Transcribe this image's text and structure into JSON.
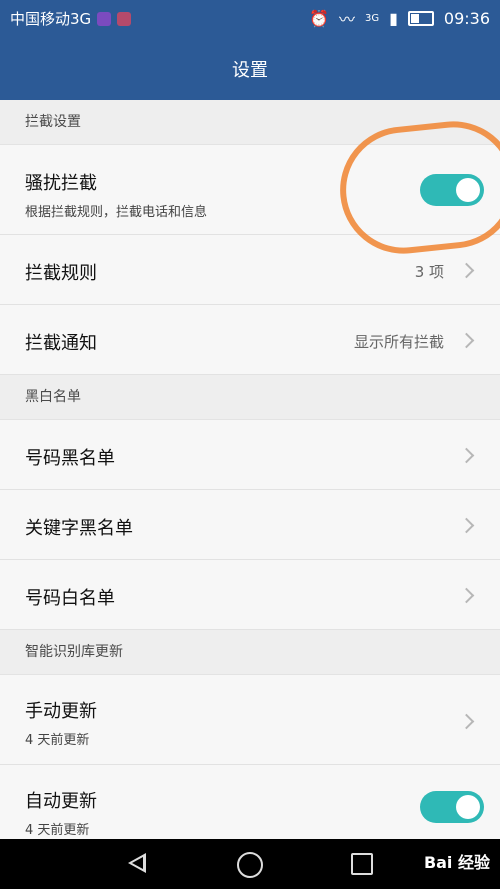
{
  "status_bar": {
    "carrier": "中国移动3G",
    "time": "09:36",
    "network_tag": "3G"
  },
  "title_bar": {
    "title": "设置"
  },
  "sections": [
    {
      "header": "拦截设置",
      "rows": [
        {
          "label": "骚扰拦截",
          "sub": "根据拦截规则，拦截电话和信息",
          "toggle": true
        },
        {
          "label": "拦截规则",
          "value": "3 项"
        },
        {
          "label": "拦截通知",
          "value": "显示所有拦截"
        }
      ]
    },
    {
      "header": "黑白名单",
      "rows": [
        {
          "label": "号码黑名单"
        },
        {
          "label": "关键字黑名单"
        },
        {
          "label": "号码白名单"
        }
      ]
    },
    {
      "header": "智能识别库更新",
      "rows": [
        {
          "label": "手动更新",
          "sub": "4 天前更新"
        },
        {
          "label": "自动更新",
          "sub": "4 天前更新",
          "toggle": true
        }
      ]
    }
  ],
  "watermark": {
    "text": "Bai 经验"
  },
  "colors": {
    "header_blue": "#2c5a96",
    "toggle_teal": "#2fb9b6",
    "annotation_orange": "#f08a3b"
  },
  "icons": {
    "wifi": "wifi-icon",
    "battery": "battery-icon",
    "alarm": "alarm-icon"
  }
}
